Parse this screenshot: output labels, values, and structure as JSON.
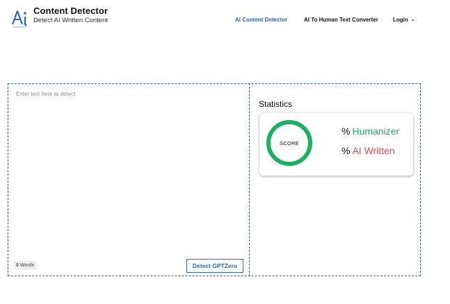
{
  "brand": {
    "logo_text": "Ai",
    "title": "Content Detector",
    "subtitle": "Detect AI Written Content"
  },
  "nav": {
    "items": [
      {
        "label": "AI Content Detector",
        "active": true
      },
      {
        "label": "AI To Human Text Converter",
        "active": false
      },
      {
        "label": "Login",
        "active": false
      }
    ],
    "login_icon": "chevron-down-icon"
  },
  "editor": {
    "value": "",
    "placeholder": "Enter text here to detect",
    "word_count": "0",
    "word_label": "Words",
    "detect_label": "Detect GPTZero"
  },
  "statistics": {
    "title": "Statistics",
    "score_label": "SCORE",
    "humanizer_prefix": "%",
    "humanizer_label": "Humanizer",
    "ai_prefix": "%",
    "ai_label": "AI Written"
  },
  "colors": {
    "accent": "#2b63c6",
    "human": "#17b363",
    "ai": "#ee4b4b"
  }
}
